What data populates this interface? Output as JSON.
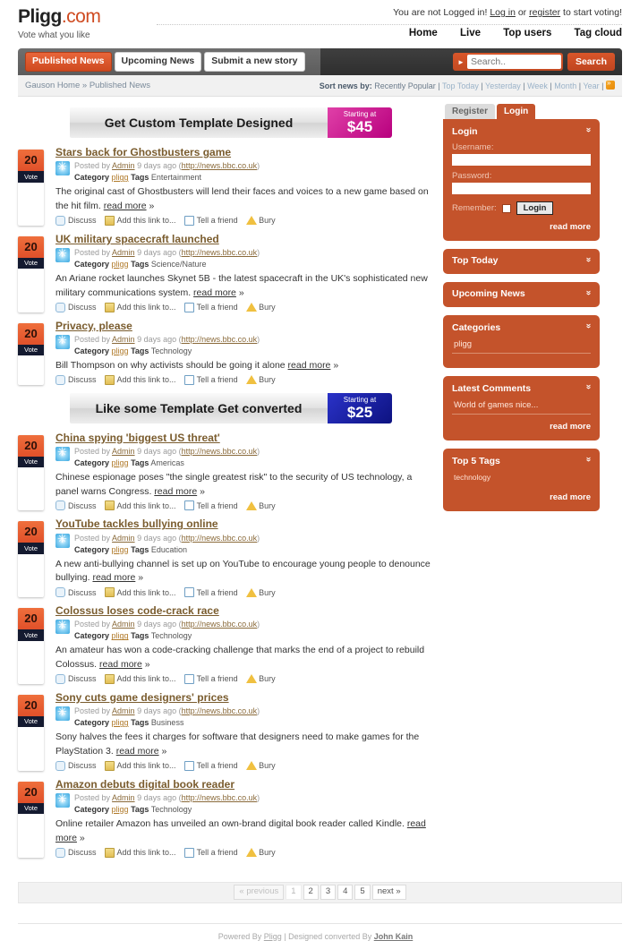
{
  "header": {
    "logo_main": "Pligg",
    "logo_suffix": ".com",
    "tagline": "Vote what you like",
    "login_prefix": "You are not Logged in!",
    "login_link": "Log in",
    "login_or": "or",
    "register_link": "register",
    "login_suffix": "to start voting!",
    "nav": [
      {
        "label": "Home"
      },
      {
        "label": "Live"
      },
      {
        "label": "Top users"
      },
      {
        "label": "Tag cloud"
      }
    ]
  },
  "tabbar": {
    "tabs": [
      {
        "label": "Published News",
        "active": true
      },
      {
        "label": "Upcoming News",
        "active": false
      },
      {
        "label": "Submit a new story",
        "active": false
      }
    ],
    "search_placeholder": "Search..",
    "search_value": "",
    "search_button": "Search"
  },
  "subbar": {
    "breadcrumb_home": "Gauson Home",
    "breadcrumb_sep": "»",
    "breadcrumb_current": "Published News",
    "sort_label": "Sort news by:",
    "sort_options": [
      "Recently Popular",
      "Top Today",
      "Yesterday",
      "Week",
      "Month",
      "Year"
    ]
  },
  "banners": [
    {
      "text": "Get Custom Template Designed",
      "price_small": "Starting at",
      "price_big": "$45",
      "color": "#cc1b8d"
    },
    {
      "text": "Like some Template Get converted",
      "price_small": "Starting at",
      "price_big": "$25",
      "color": "#1a1f9e"
    }
  ],
  "stories": [
    {
      "votes": "20",
      "vote_label": "Vote",
      "title": "Stars back for Ghostbusters game",
      "posted_by": "Posted by",
      "author": "Admin",
      "age": "9 days ago",
      "source": "http://news.bbc.co.uk",
      "category_label": "Category",
      "category": "pligg",
      "tags_label": "Tags",
      "tags": "Entertainment",
      "description": "The original cast of Ghostbusters will lend their faces and voices to a new game based on the hit film.",
      "read_more": "read more"
    },
    {
      "votes": "20",
      "vote_label": "Vote",
      "title": "UK military spacecraft launched",
      "posted_by": "Posted by",
      "author": "Admin",
      "age": "9 days ago",
      "source": "http://news.bbc.co.uk",
      "category_label": "Category",
      "category": "pligg",
      "tags_label": "Tags",
      "tags": "Science/Nature",
      "description": "An Ariane rocket launches Skynet 5B - the latest spacecraft in the UK's sophisticated new military communications system.",
      "read_more": "read more"
    },
    {
      "votes": "20",
      "vote_label": "Vote",
      "title": "Privacy, please",
      "posted_by": "Posted by",
      "author": "Admin",
      "age": "9 days ago",
      "source": "http://news.bbc.co.uk",
      "category_label": "Category",
      "category": "pligg",
      "tags_label": "Tags",
      "tags": "Technology",
      "description": "Bill Thompson on why activists should be going it alone",
      "read_more": "read more"
    },
    {
      "votes": "20",
      "vote_label": "Vote",
      "title": "China spying 'biggest US threat'",
      "posted_by": "Posted by",
      "author": "Admin",
      "age": "9 days ago",
      "source": "http://news.bbc.co.uk",
      "category_label": "Category",
      "category": "pligg",
      "tags_label": "Tags",
      "tags": "Americas",
      "description": "Chinese espionage poses \"the single greatest risk\" to the security of US technology, a panel warns Congress.",
      "read_more": "read more"
    },
    {
      "votes": "20",
      "vote_label": "Vote",
      "title": "YouTube tackles bullying online",
      "posted_by": "Posted by",
      "author": "Admin",
      "age": "9 days ago",
      "source": "http://news.bbc.co.uk",
      "category_label": "Category",
      "category": "pligg",
      "tags_label": "Tags",
      "tags": "Education",
      "description": "A new anti-bullying channel is set up on YouTube to encourage young people to denounce bullying.",
      "read_more": "read more"
    },
    {
      "votes": "20",
      "vote_label": "Vote",
      "title": "Colossus loses code-crack race",
      "posted_by": "Posted by",
      "author": "Admin",
      "age": "9 days ago",
      "source": "http://news.bbc.co.uk",
      "category_label": "Category",
      "category": "pligg",
      "tags_label": "Tags",
      "tags": "Technology",
      "description": "An amateur has won a code-cracking challenge that marks the end of a project to rebuild Colossus.",
      "read_more": "read more"
    },
    {
      "votes": "20",
      "vote_label": "Vote",
      "title": "Sony cuts game designers' prices",
      "posted_by": "Posted by",
      "author": "Admin",
      "age": "9 days ago",
      "source": "http://news.bbc.co.uk",
      "category_label": "Category",
      "category": "pligg",
      "tags_label": "Tags",
      "tags": "Business",
      "description": "Sony halves the fees it charges for software that designers need to make games for the PlayStation 3.",
      "read_more": "read more"
    },
    {
      "votes": "20",
      "vote_label": "Vote",
      "title": "Amazon debuts digital book reader",
      "posted_by": "Posted by",
      "author": "Admin",
      "age": "9 days ago",
      "source": "http://news.bbc.co.uk",
      "category_label": "Category",
      "category": "pligg",
      "tags_label": "Tags",
      "tags": "Technology",
      "description": "Online retailer Amazon has unveiled an own-brand digital book reader called Kindle.",
      "read_more": "read more"
    }
  ],
  "story_actions": [
    {
      "label": "Discuss",
      "icon": "comment-icon"
    },
    {
      "label": "Add this link to...",
      "icon": "bookmark-icon"
    },
    {
      "label": "Tell a friend",
      "icon": "mail-icon"
    },
    {
      "label": "Bury",
      "icon": "warning-icon"
    }
  ],
  "sidebar": {
    "tabs": [
      {
        "label": "Register",
        "active": false
      },
      {
        "label": "Login",
        "active": true
      }
    ],
    "login_panel": {
      "title": "Login",
      "username_label": "Username:",
      "username_value": "",
      "password_label": "Password:",
      "password_value": "",
      "remember_label": "Remember:",
      "submit_label": "Login",
      "read_more": "read more"
    },
    "panels": [
      {
        "title": "Top Today",
        "items": [],
        "read_more": ""
      },
      {
        "title": "Upcoming News",
        "items": [],
        "read_more": ""
      },
      {
        "title": "Categories",
        "items": [
          "pligg"
        ],
        "read_more": ""
      },
      {
        "title": "Latest Comments",
        "items": [
          "World of games nice..."
        ],
        "read_more": "read more"
      },
      {
        "title": "Top 5 Tags",
        "items": [
          "technology"
        ],
        "read_more": "read more"
      }
    ]
  },
  "pagination": {
    "previous": "« previous",
    "pages": [
      "1",
      "2",
      "3",
      "4",
      "5"
    ],
    "current": "1",
    "next": "next »"
  },
  "footer": {
    "powered_prefix": "Powered By",
    "powered_link": "Pligg",
    "sep": "| Designed converted By",
    "designer": "John Kain"
  },
  "colors": {
    "accent": "#cf4a20",
    "panel": "#c4532b",
    "vote": "#e0502a",
    "vote_label_bg": "#141a30"
  }
}
